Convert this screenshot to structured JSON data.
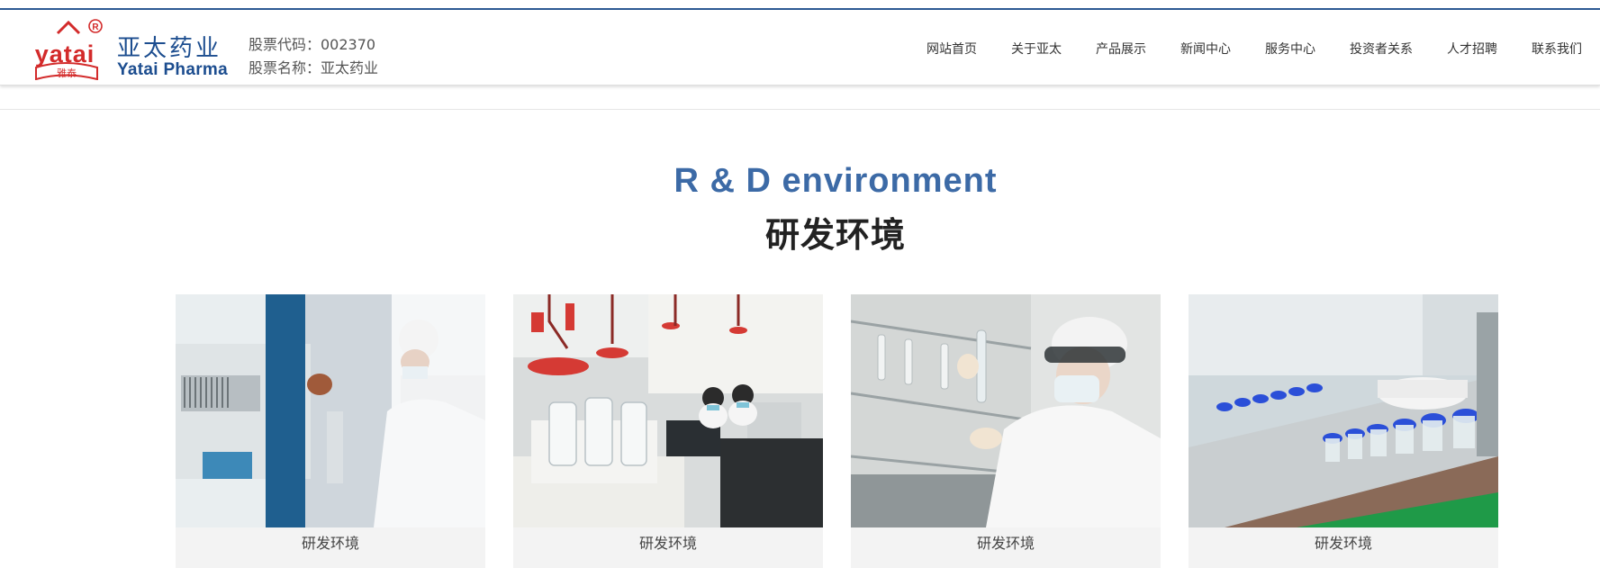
{
  "brand": {
    "logo_text": "yatai",
    "logo_sub": "雅泰",
    "name_cn": "亚太药业",
    "name_en": "Yatai Pharma",
    "color": "#1c4d8f",
    "logo_color": "#d32b2b"
  },
  "stock": {
    "code": "股票代码：002370",
    "name": "股票名称：亚太药业"
  },
  "nav": {
    "items": [
      "网站首页",
      "关于亚太",
      "产品展示",
      "新闻中心",
      "服务中心",
      "投资者关系",
      "人才招聘",
      "联系我们"
    ]
  },
  "section": {
    "title_en": "R & D environment",
    "title_cn": "研发环境",
    "title_en_color": "#3c6aa6"
  },
  "cards": [
    {
      "caption": "研发环境",
      "image": "lab-technician-pipette-photo"
    },
    {
      "caption": "研发环境",
      "image": "chemistry-lab-fume-hoods-photo"
    },
    {
      "caption": "研发环境",
      "image": "researcher-goggles-test-tube-photo"
    },
    {
      "caption": "研发环境",
      "image": "vial-production-line-photo"
    }
  ]
}
